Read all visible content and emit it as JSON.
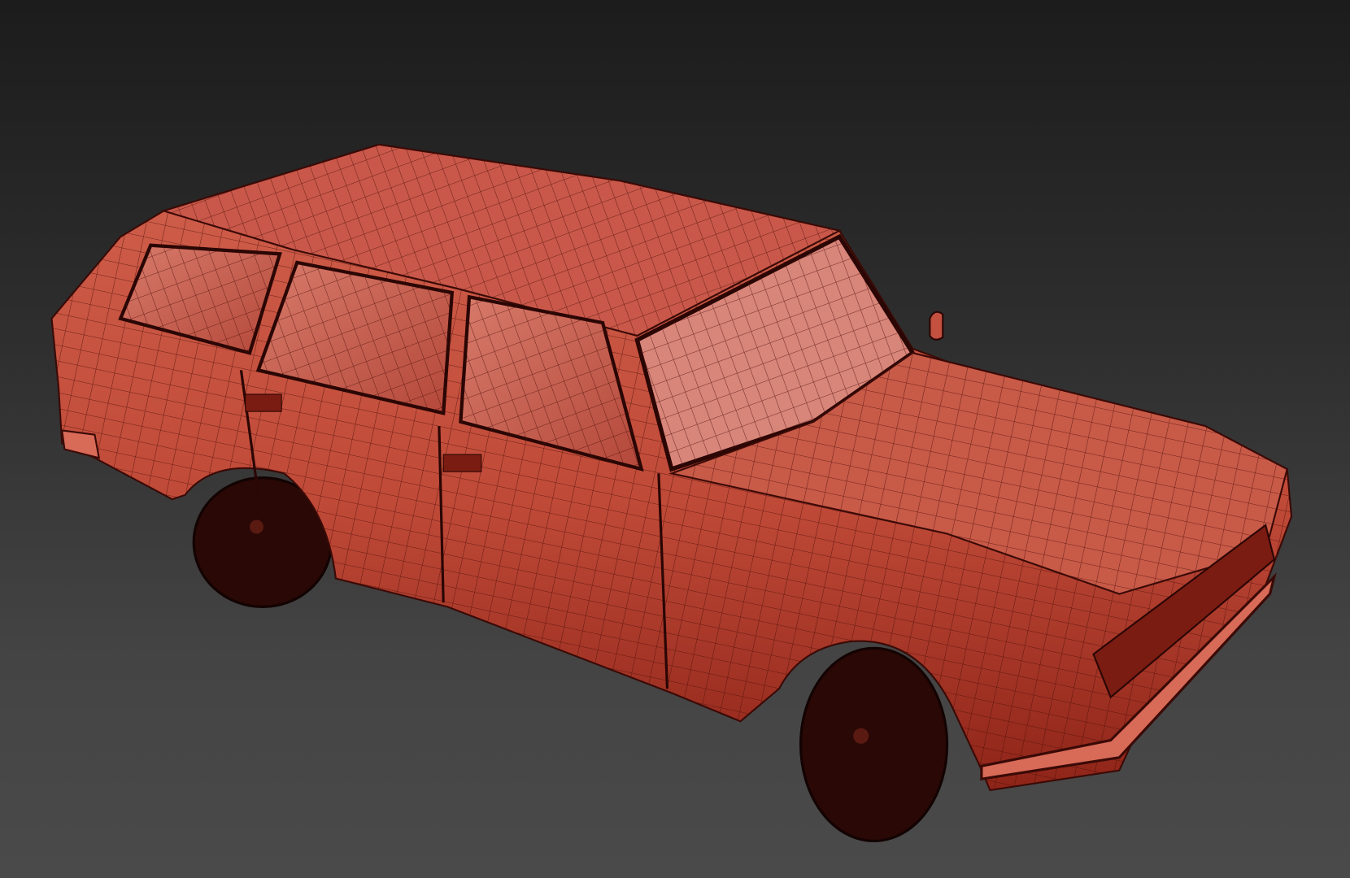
{
  "scene": {
    "subject": "car-wireframe-model",
    "colors": {
      "body": "#c4503f",
      "body_shadow": "#9a2a1e",
      "wire": "#4a0d08",
      "wheel": "#2a0806",
      "background_top": "#1c1c1c",
      "background_bottom": "#4a4a4a"
    }
  }
}
